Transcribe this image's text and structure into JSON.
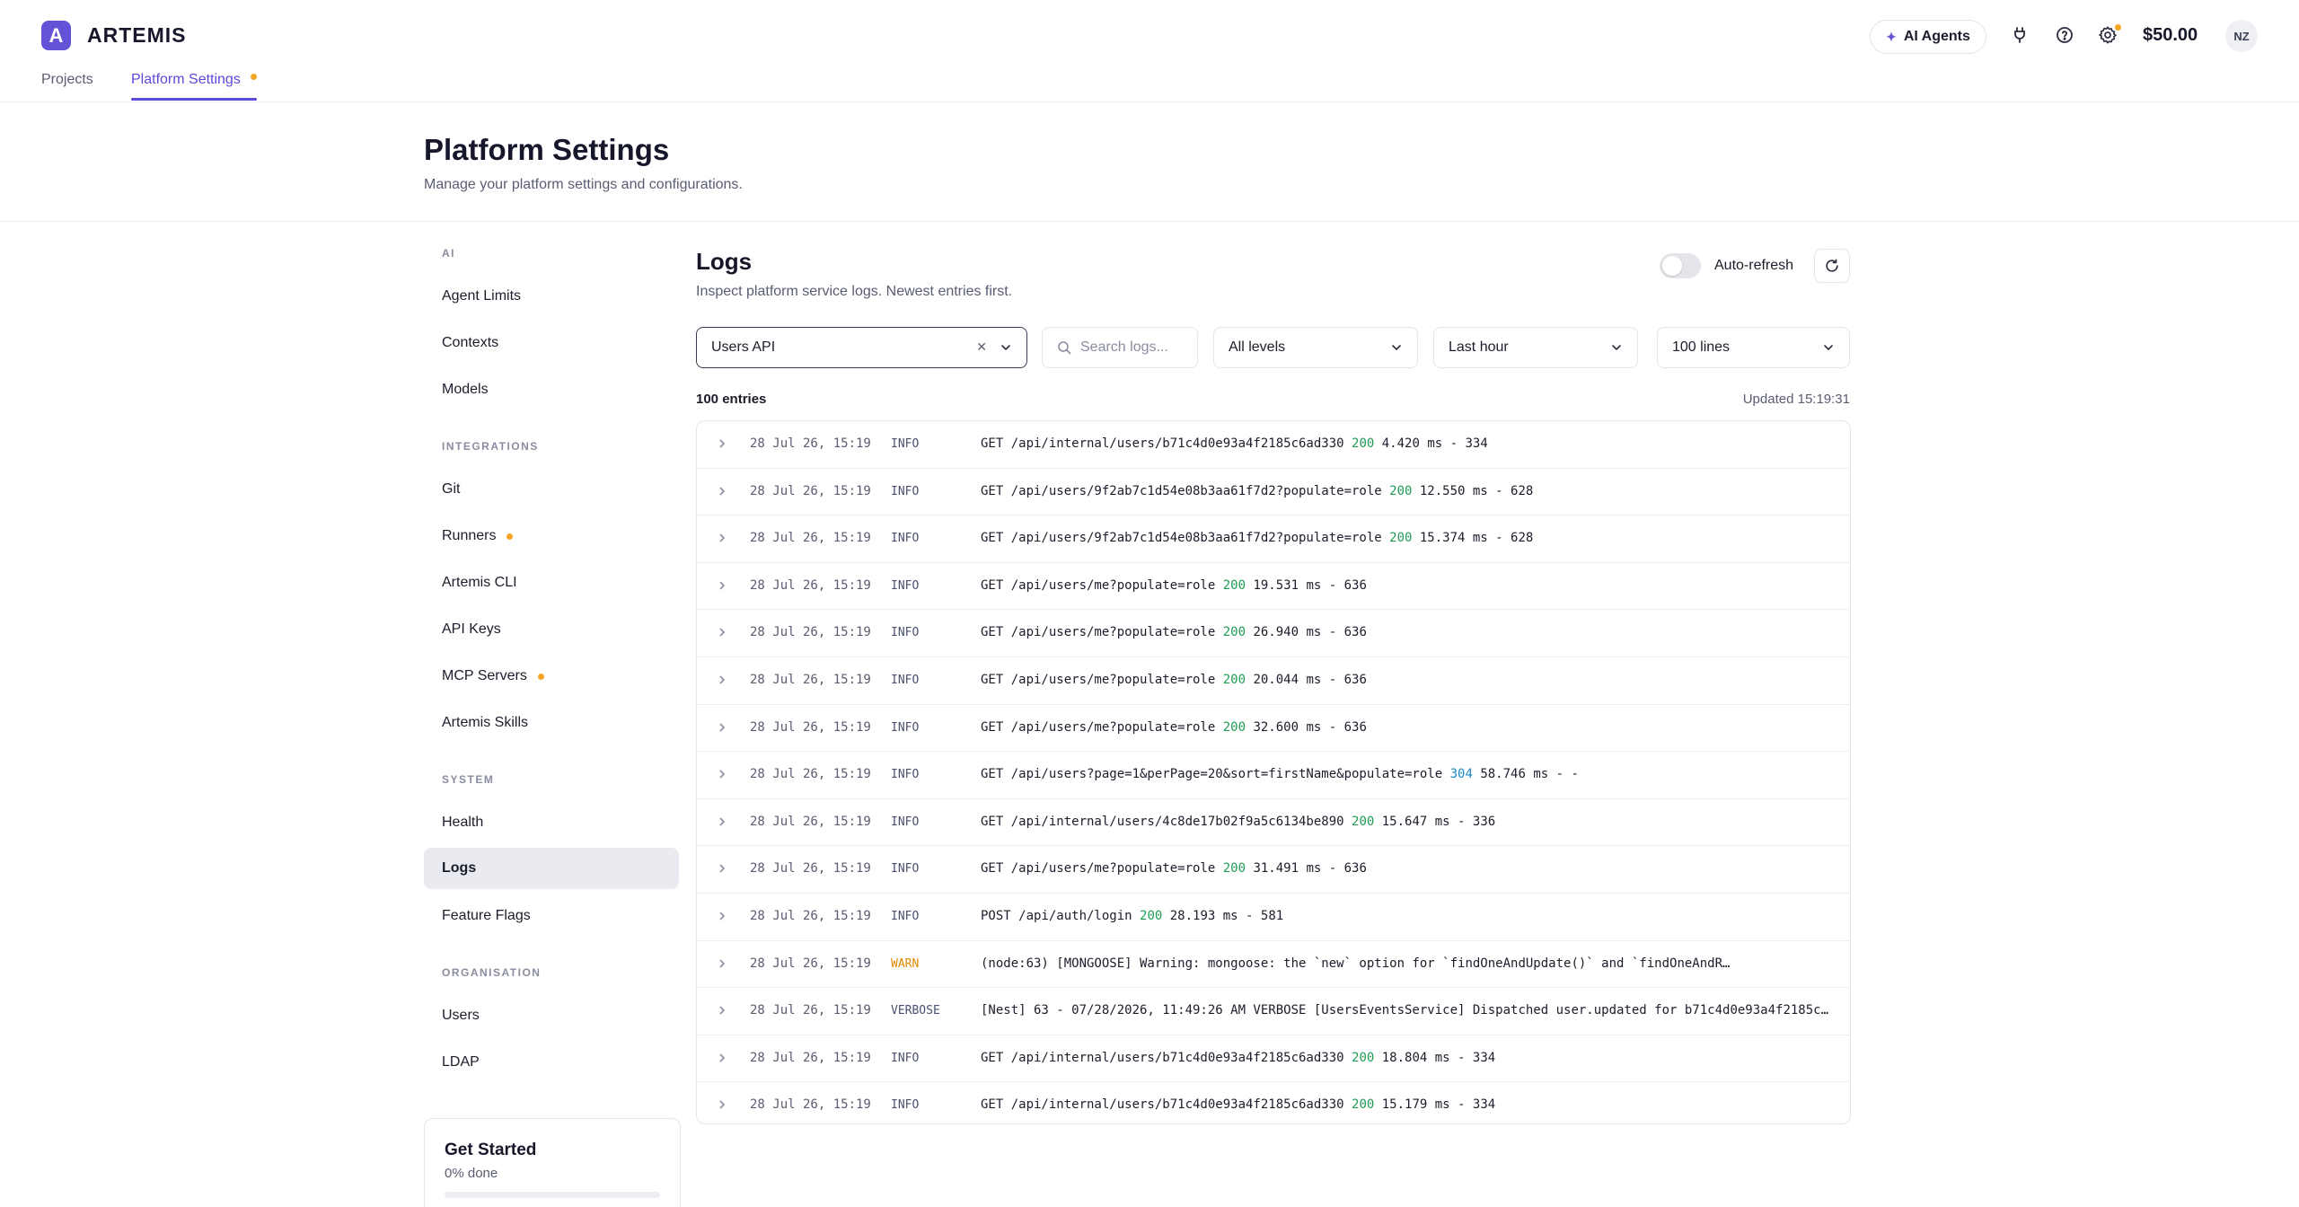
{
  "app": {
    "logo_letter": "A",
    "brand": "ARTEMIS",
    "tabs": [
      "Projects",
      "Platform Settings"
    ],
    "ai_agents_label": "AI Agents",
    "balance": "$50.00",
    "avatar_initials": "NZ",
    "accent_color": "#6453d6",
    "dot_color": "#f5a524"
  },
  "page": {
    "title": "Platform Settings",
    "subtitle": "Manage your platform settings and configurations."
  },
  "sidebar": {
    "sections": [
      "AI",
      "INTEGRATIONS",
      "SYSTEM",
      "ORGANISATION"
    ],
    "items": [
      {
        "label": "Agent Limits"
      },
      {
        "label": "Contexts"
      },
      {
        "label": "Models"
      },
      {
        "label": "Git"
      },
      {
        "label": "Runners",
        "dot": true
      },
      {
        "label": "Artemis CLI"
      },
      {
        "label": "API Keys"
      },
      {
        "label": "MCP Servers",
        "dot": true
      },
      {
        "label": "Artemis Skills"
      },
      {
        "label": "Health"
      },
      {
        "label": "Logs",
        "active": true
      },
      {
        "label": "Feature Flags"
      },
      {
        "label": "Users"
      },
      {
        "label": "LDAP"
      }
    ],
    "get_started": {
      "title": "Get Started",
      "progress_text": "0% done",
      "progress": 0
    }
  },
  "logs": {
    "title": "Logs",
    "subtitle": "Inspect platform service logs. Newest entries first.",
    "auto_refresh_label": "Auto-refresh",
    "auto_refresh_on": false,
    "filters": {
      "service": "Users API",
      "search_placeholder": "Search logs...",
      "level": "All levels",
      "time_range": "Last hour",
      "lines": "100 lines"
    },
    "entries_count": "100 entries",
    "updated": "Updated 15:19:31",
    "rows": [
      {
        "ts": "28 Jul 26, 15:19",
        "level": "INFO",
        "pre": "GET /api/internal/users/b71c4d0e93a4f2185c6ad330 ",
        "status": "200",
        "post": " 4.420 ms - 334"
      },
      {
        "ts": "28 Jul 26, 15:19",
        "level": "INFO",
        "pre": "GET /api/users/9f2ab7c1d54e08b3aa61f7d2?populate=role ",
        "status": "200",
        "post": " 12.550 ms - 628"
      },
      {
        "ts": "28 Jul 26, 15:19",
        "level": "INFO",
        "pre": "GET /api/users/9f2ab7c1d54e08b3aa61f7d2?populate=role ",
        "status": "200",
        "post": " 15.374 ms - 628"
      },
      {
        "ts": "28 Jul 26, 15:19",
        "level": "INFO",
        "pre": "GET /api/users/me?populate=role ",
        "status": "200",
        "post": " 19.531 ms - 636"
      },
      {
        "ts": "28 Jul 26, 15:19",
        "level": "INFO",
        "pre": "GET /api/users/me?populate=role ",
        "status": "200",
        "post": " 26.940 ms - 636"
      },
      {
        "ts": "28 Jul 26, 15:19",
        "level": "INFO",
        "pre": "GET /api/users/me?populate=role ",
        "status": "200",
        "post": " 20.044 ms - 636"
      },
      {
        "ts": "28 Jul 26, 15:19",
        "level": "INFO",
        "pre": "GET /api/users/me?populate=role ",
        "status": "200",
        "post": " 32.600 ms - 636"
      },
      {
        "ts": "28 Jul 26, 15:19",
        "level": "INFO",
        "pre": "GET /api/users?page=1&perPage=20&sort=firstName&populate=role ",
        "status": "304",
        "post": " 58.746 ms - -"
      },
      {
        "ts": "28 Jul 26, 15:19",
        "level": "INFO",
        "pre": "GET /api/internal/users/4c8de17b02f9a5c6134be890 ",
        "status": "200",
        "post": " 15.647 ms - 336"
      },
      {
        "ts": "28 Jul 26, 15:19",
        "level": "INFO",
        "pre": "GET /api/users/me?populate=role ",
        "status": "200",
        "post": " 31.491 ms - 636"
      },
      {
        "ts": "28 Jul 26, 15:19",
        "level": "INFO",
        "pre": "POST /api/auth/login ",
        "status": "200",
        "post": " 28.193 ms - 581"
      },
      {
        "ts": "28 Jul 26, 15:19",
        "level": "WARN",
        "pre": "(node:63) [MONGOOSE] Warning: mongoose: the `new` option for `findOneAndUpdate()` and `findOneAndR…",
        "status": "",
        "post": ""
      },
      {
        "ts": "28 Jul 26, 15:19",
        "level": "VERBOSE",
        "pre": "[Nest] 63 - 07/28/2026, 11:49:26 AM VERBOSE [UsersEventsService] Dispatched user.updated for b71c4d0e93a4f2185c…",
        "status": "",
        "post": ""
      },
      {
        "ts": "28 Jul 26, 15:19",
        "level": "INFO",
        "pre": "GET /api/internal/users/b71c4d0e93a4f2185c6ad330 ",
        "status": "200",
        "post": " 18.804 ms - 334"
      },
      {
        "ts": "28 Jul 26, 15:19",
        "level": "INFO",
        "pre": "GET /api/internal/users/b71c4d0e93a4f2185c6ad330 ",
        "status": "200",
        "post": " 15.179 ms - 334"
      }
    ]
  }
}
